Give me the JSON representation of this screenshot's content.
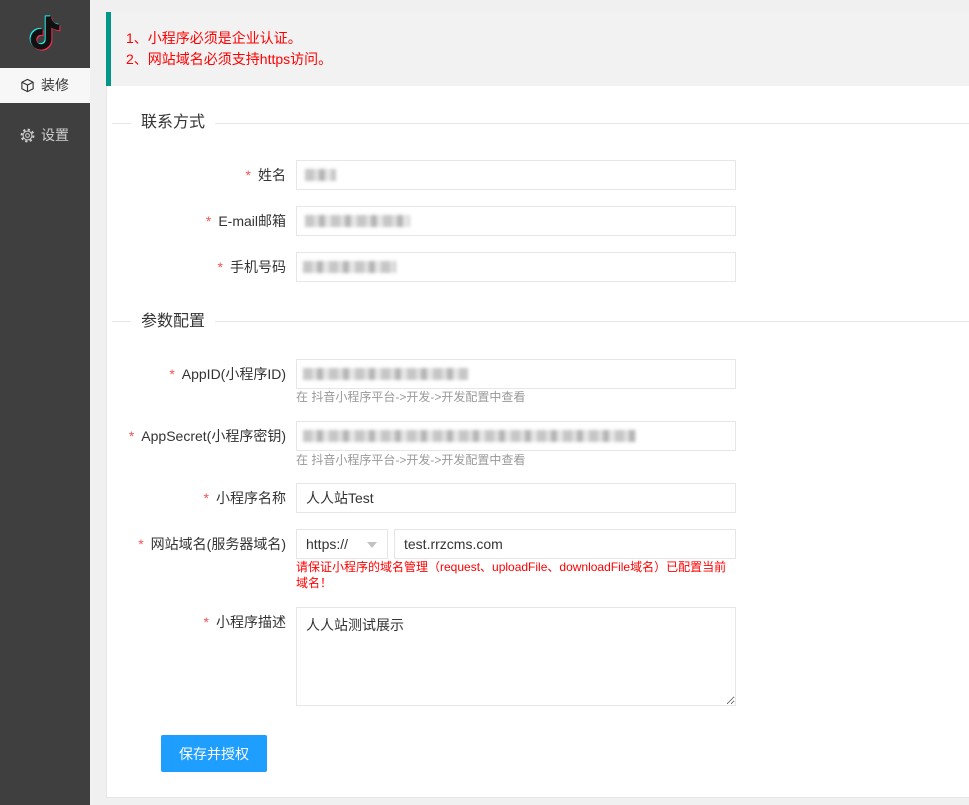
{
  "sidebar": {
    "logo_icon": "tiktok-logo",
    "items": [
      {
        "label": "装修",
        "icon": "cube-icon",
        "active": true
      },
      {
        "label": "设置",
        "icon": "gear-icon",
        "active": false
      }
    ]
  },
  "notice": {
    "lines": [
      "1、小程序必须是企业认证。",
      "2、网站域名必须支持https访问。"
    ]
  },
  "sections": {
    "contact": {
      "legend": "联系方式"
    },
    "params": {
      "legend": "参数配置"
    }
  },
  "form": {
    "required_mark": "*",
    "name": {
      "label": "姓名"
    },
    "email": {
      "label": "E-mail邮箱"
    },
    "mobile": {
      "label": "手机号码"
    },
    "appid": {
      "label": "AppID(小程序ID)",
      "help": "在 抖音小程序平台->开发->开发配置中查看"
    },
    "appsecret": {
      "label": "AppSecret(小程序密钥)",
      "help": "在 抖音小程序平台->开发->开发配置中查看"
    },
    "app_name": {
      "label": "小程序名称",
      "value": "人人站Test"
    },
    "domain": {
      "label": "网站域名(服务器域名)",
      "protocol": "https://",
      "value": "test.rrzcms.com",
      "warning": "请保证小程序的域名管理（request、uploadFile、downloadFile域名）已配置当前域名！"
    },
    "description": {
      "label": "小程序描述",
      "value": "人人站测试展示"
    }
  },
  "submit": {
    "label": "保存并授权"
  },
  "colors": {
    "sidebar_bg": "#3f3f3f",
    "notice_accent": "#009688",
    "notice_text": "#ff0000",
    "required_mark": "#ee5555",
    "button_bg": "#1E9FFF"
  }
}
